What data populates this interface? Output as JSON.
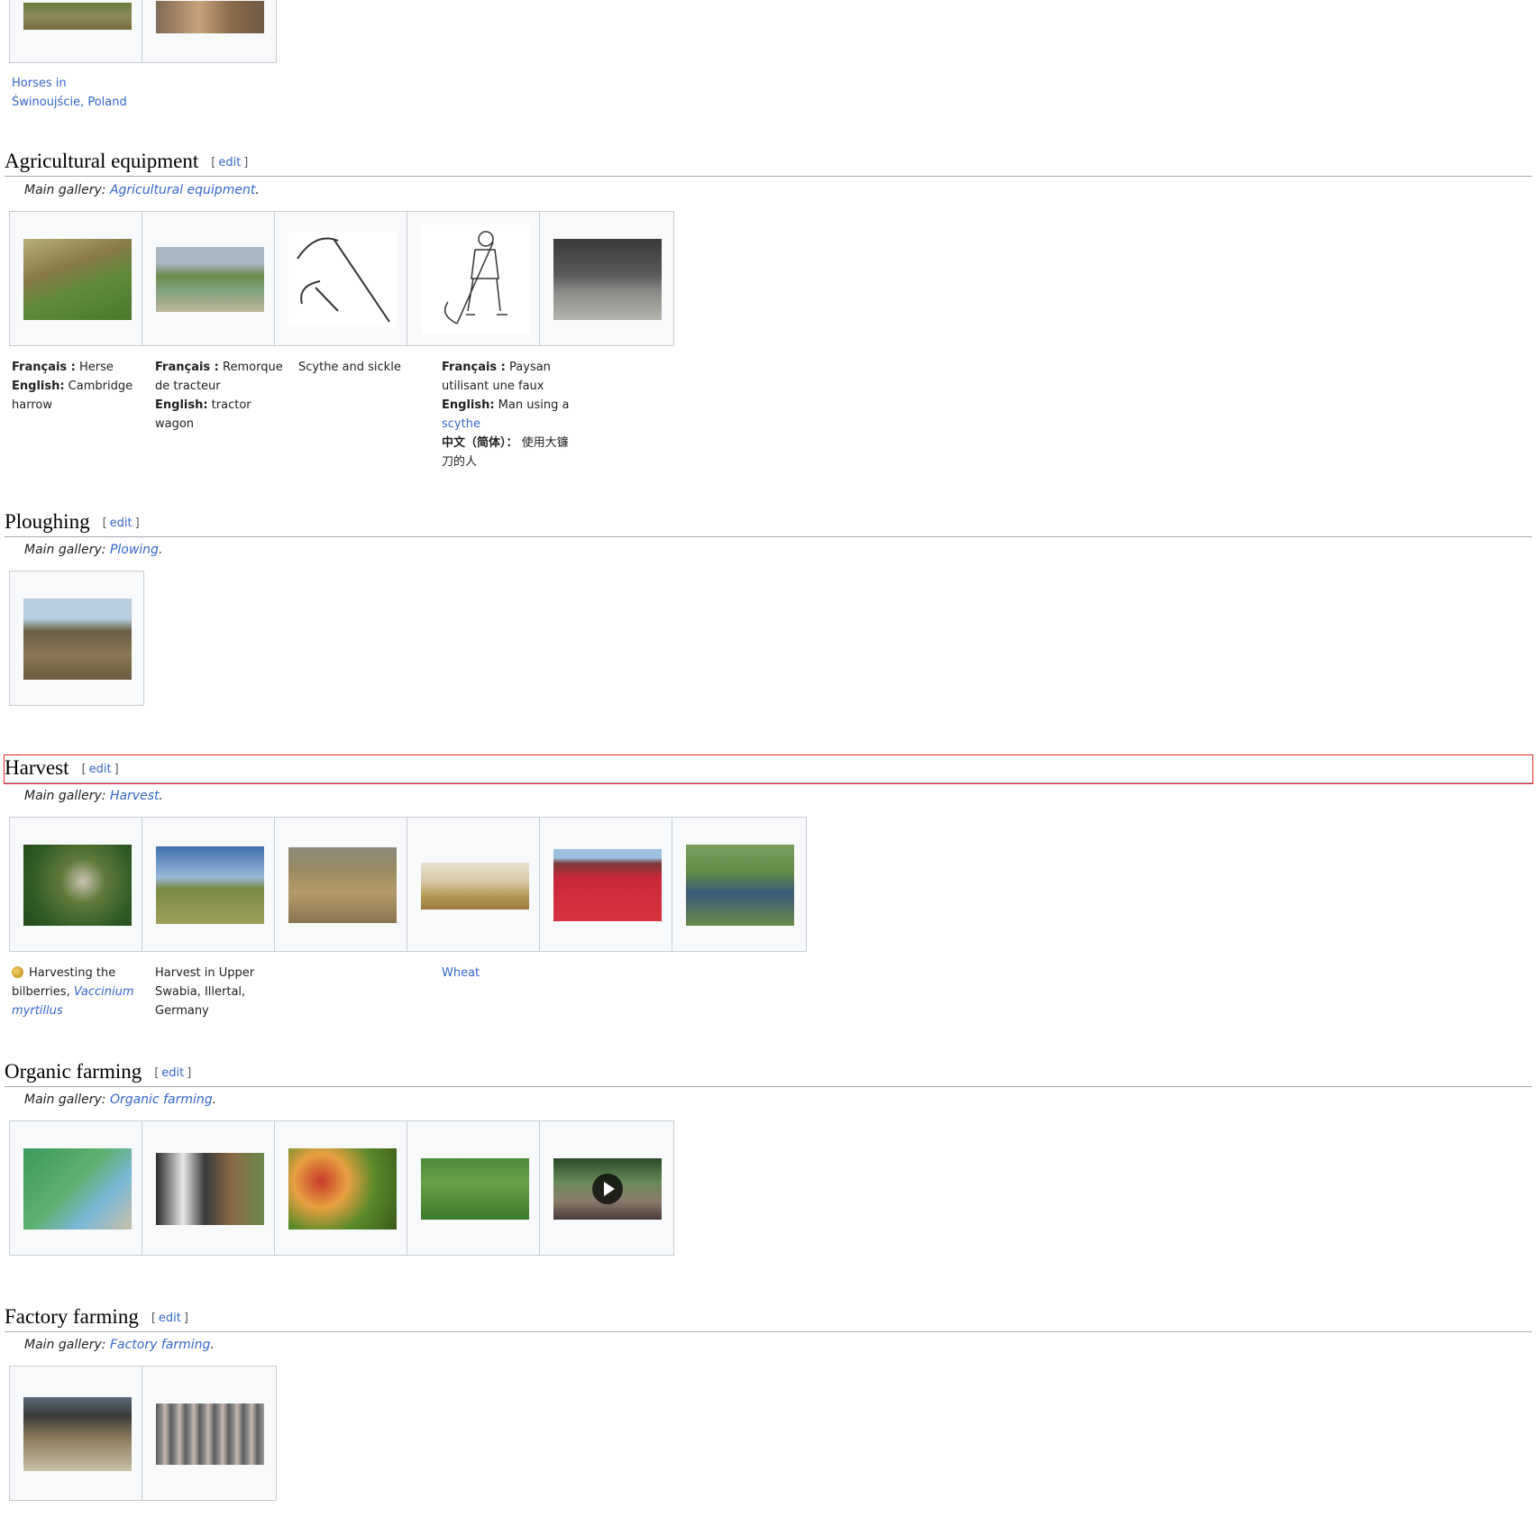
{
  "edit_label": "edit",
  "bracket_open": "[",
  "bracket_close": "]",
  "top_caption": {
    "link": "Horses in Świnoujście, Poland"
  },
  "sections": {
    "equipment": {
      "title": "Agricultural equipment",
      "hatnote_prefix": "Main gallery: ",
      "hatnote_link": "Agricultural equipment",
      "hatnote_suffix": ".",
      "captions": {
        "harrow": {
          "fr_label": "Français :",
          "fr_text": " Herse",
          "en_label": "English:",
          "en_text": " Cambridge harrow"
        },
        "wagon": {
          "fr_label": "Français :",
          "fr_text": " Remorque de tracteur",
          "en_label": "English:",
          "en_text": " tractor wagon"
        },
        "scythe_sickle": "Scythe and sickle",
        "peasant": {
          "fr_label": "Français :",
          "fr_text": " Paysan utilisant une faux",
          "en_label": "English:",
          "en_text": " Man using a ",
          "en_link": "scythe",
          "zh_label": "中文（简体）：",
          "zh_text": " 使用大镰刀的人"
        }
      }
    },
    "ploughing": {
      "title": "Ploughing",
      "hatnote_prefix": "Main gallery: ",
      "hatnote_link": "Plowing",
      "hatnote_suffix": "."
    },
    "harvest": {
      "title": "Harvest",
      "hatnote_prefix": "Main gallery: ",
      "hatnote_link": "Harvest",
      "hatnote_suffix": ".",
      "captions": {
        "bilberries": {
          "text": "Harvesting the bilberries, ",
          "link": "Vaccinium myrtillus"
        },
        "swabia": "Harvest in Upper Swabia, Illertal, Germany",
        "wheat": "Wheat"
      }
    },
    "organic": {
      "title": "Organic farming",
      "hatnote_prefix": "Main gallery: ",
      "hatnote_link": "Organic farming",
      "hatnote_suffix": "."
    },
    "factory": {
      "title": "Factory farming",
      "hatnote_prefix": "Main gallery: ",
      "hatnote_link": "Factory farming",
      "hatnote_suffix": "."
    }
  },
  "colors": {
    "link": "#3366cc",
    "border": "#c8ccd1",
    "box_bg": "#f8f9fa",
    "focus": "#e8282d"
  }
}
